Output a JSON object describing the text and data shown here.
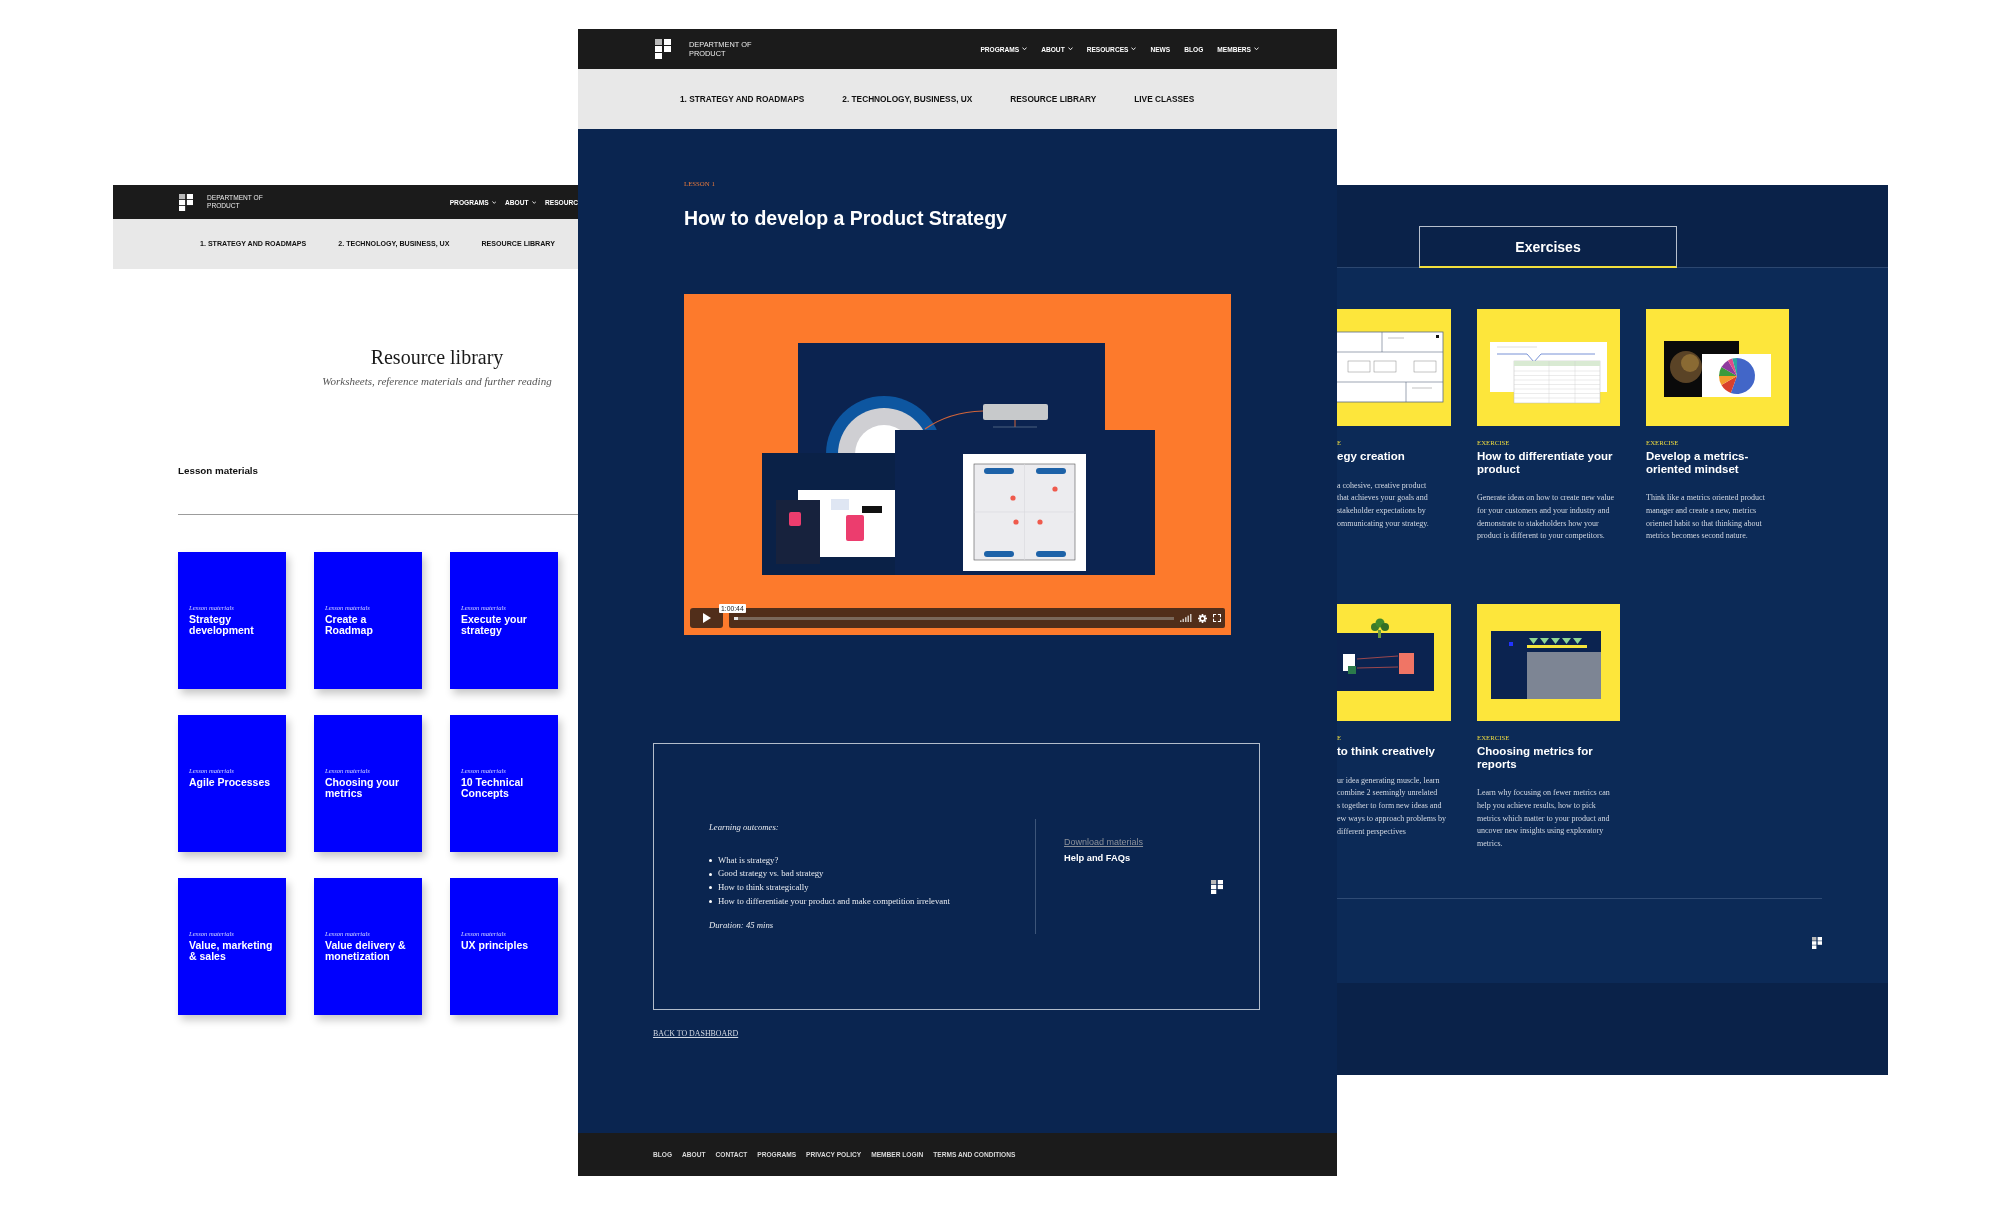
{
  "library_page": {
    "brand": "DEPARTMENT OF PRODUCT",
    "nav": [
      {
        "label": "PROGRAMS",
        "dropdown": true
      },
      {
        "label": "ABOUT",
        "dropdown": true
      },
      {
        "label": "RESOURC",
        "dropdown": false
      }
    ],
    "subnav": [
      "1. STRATEGY AND ROADMAPS",
      "2. TECHNOLOGY, BUSINESS, UX",
      "RESOURCE LIBRARY"
    ],
    "title": "Resource library",
    "subtitle": "Worksheets, reference materials and further reading",
    "section_title": "Lesson materials",
    "cards": [
      {
        "label": "Lesson materials",
        "title": "Strategy development"
      },
      {
        "label": "Lesson materials",
        "title": "Create a Roadmap"
      },
      {
        "label": "Lesson materials",
        "title": "Execute your strategy"
      },
      {
        "label": "Lesson materials",
        "title": "Agile Processes"
      },
      {
        "label": "Lesson materials",
        "title": "Choosing your metrics"
      },
      {
        "label": "Lesson materials",
        "title": "10 Technical Concepts"
      },
      {
        "label": "Lesson materials",
        "title": "Value, marketing & sales"
      },
      {
        "label": "Lesson materials",
        "title": "Value delivery & monetization"
      },
      {
        "label": "Lesson materials",
        "title": "UX principles"
      }
    ]
  },
  "lesson_page": {
    "brand": "DEPARTMENT OF PRODUCT",
    "nav": [
      {
        "label": "PROGRAMS",
        "dropdown": true
      },
      {
        "label": "ABOUT",
        "dropdown": true
      },
      {
        "label": "RESOURCES",
        "dropdown": true
      },
      {
        "label": "NEWS",
        "dropdown": false
      },
      {
        "label": "BLOG",
        "dropdown": false
      },
      {
        "label": "MEMBERS",
        "dropdown": true
      }
    ],
    "subnav": [
      "1. STRATEGY AND ROADMAPS",
      "2. TECHNOLOGY, BUSINESS, UX",
      "RESOURCE LIBRARY",
      "LIVE CLASSES"
    ],
    "eyebrow": "LESSON 1",
    "title": "How to develop a Product Strategy",
    "video": {
      "time": "1:00:44",
      "level": 0.01
    },
    "outcomes": {
      "heading": "Learning outcomes:",
      "items": [
        "What is strategy?",
        "Good strategy vs. bad strategy",
        "How to think strategically",
        "How to differentiate your product and make competition irrelevant"
      ],
      "duration": "Duration: 45 mins"
    },
    "links": [
      {
        "label": "Download materials",
        "kind": "muted"
      },
      {
        "label": "Help and FAQs",
        "kind": "strong"
      }
    ],
    "back_link": "BACK TO DASHBOARD",
    "footer_links": [
      "BLOG",
      "ABOUT",
      "CONTACT",
      "PROGRAMS",
      "PRIVACY POLICY",
      "MEMBER LOGIN",
      "TERMS AND CONDITIONS"
    ]
  },
  "exercises_page": {
    "tabs": [
      {
        "label": "Exercises",
        "selected": true
      }
    ],
    "exercises": [
      {
        "kind": "board",
        "label": "E",
        "title": "egy creation",
        "description": "a cohesive, creative product\nthat achieves your goals and\nstakeholder expectations by\nommunicating your strategy."
      },
      {
        "kind": "table",
        "label": "EXERCISE",
        "title": "How to differentiate your product",
        "description": "Generate ideas on how to create new value for your customers and your industry and demonstrate to stakeholders how your product is different to your competitors."
      },
      {
        "kind": "pie",
        "label": "EXERCISE",
        "title": "Develop a metrics-oriented mindset",
        "description": "Think like a metrics oriented product manager and create a new, metrics oriented habit so that thinking about metrics becomes second nature."
      },
      {
        "kind": "flow",
        "label": "E",
        "title": "to think creatively",
        "description": "ur idea generating muscle, learn\ncombine 2 seemingly unrelated\ns together to form new ideas and\new ways to approach problems by\ndifferent perspectives"
      },
      {
        "kind": "photo",
        "label": "EXERCISE",
        "title": "Choosing metrics for reports",
        "description": "Learn why focusing on fewer metrics can help you achieve results, how to pick metrics which matter to your product and uncover new insights using exploratory metrics."
      }
    ]
  }
}
